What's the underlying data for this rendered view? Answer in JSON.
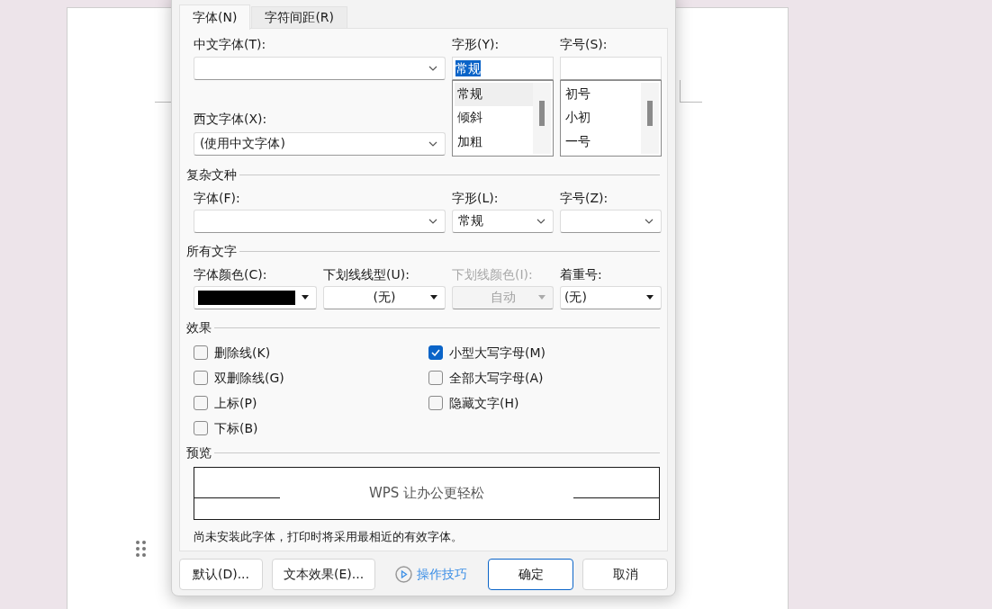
{
  "tabs": [
    {
      "label": "字体(N)",
      "selected": true
    },
    {
      "label": "字符间距(R)",
      "selected": false
    }
  ],
  "font": {
    "chinese_font_label": "中文字体(T):",
    "western_font": {
      "label": "西文字体(X):",
      "value": "(使用中文字体)"
    },
    "style": {
      "label": "字形(Y):",
      "value": "常规",
      "options": [
        {
          "text": "常规",
          "selected": true
        },
        {
          "text": "倾斜",
          "selected": false
        },
        {
          "text": "加粗",
          "selected": false
        }
      ]
    },
    "size": {
      "label": "字号(S):",
      "options": [
        {
          "text": "初号",
          "selected": false
        },
        {
          "text": "小初",
          "selected": false
        },
        {
          "text": "一号",
          "selected": false
        }
      ]
    }
  },
  "complex_script": {
    "title": "复杂文种",
    "font_label": "字体(F):",
    "style": {
      "label": "字形(L):",
      "value": "常规"
    },
    "size_label": "字号(Z):"
  },
  "all_text": {
    "title": "所有文字",
    "fields": [
      {
        "kind": "color",
        "label": "字体颜色(C):",
        "color": "#000000",
        "disabled": false
      },
      {
        "kind": "centered",
        "label": "下划线线型(U):",
        "value": "(无)",
        "disabled": false
      },
      {
        "kind": "centered",
        "label": "下划线颜色(I):",
        "value": "自动",
        "disabled": true
      },
      {
        "kind": "select",
        "label": "着重号:",
        "value": "(无)",
        "disabled": false
      }
    ]
  },
  "effects": {
    "title": "效果",
    "options": [
      {
        "label": "删除线(K)",
        "checked": false
      },
      {
        "label": "小型大写字母(M)",
        "checked": true
      },
      {
        "label": "双删除线(G)",
        "checked": false
      },
      {
        "label": "全部大写字母(A)",
        "checked": false
      },
      {
        "label": "上标(P)",
        "checked": false
      },
      {
        "label": "隐藏文字(H)",
        "checked": false
      },
      {
        "label": "下标(B)",
        "checked": false
      }
    ]
  },
  "preview": {
    "title": "预览",
    "sample": "WPS 让办公更轻松",
    "note": "尚未安装此字体，打印时将采用最相近的有效字体。"
  },
  "buttons": [
    {
      "kind": "plain",
      "label": "默认(D)..."
    },
    {
      "kind": "plain",
      "label": "文本效果(E)..."
    },
    {
      "kind": "link",
      "label": "操作技巧"
    },
    {
      "kind": "primary",
      "label": "确定"
    },
    {
      "kind": "plain",
      "label": "取消"
    }
  ]
}
